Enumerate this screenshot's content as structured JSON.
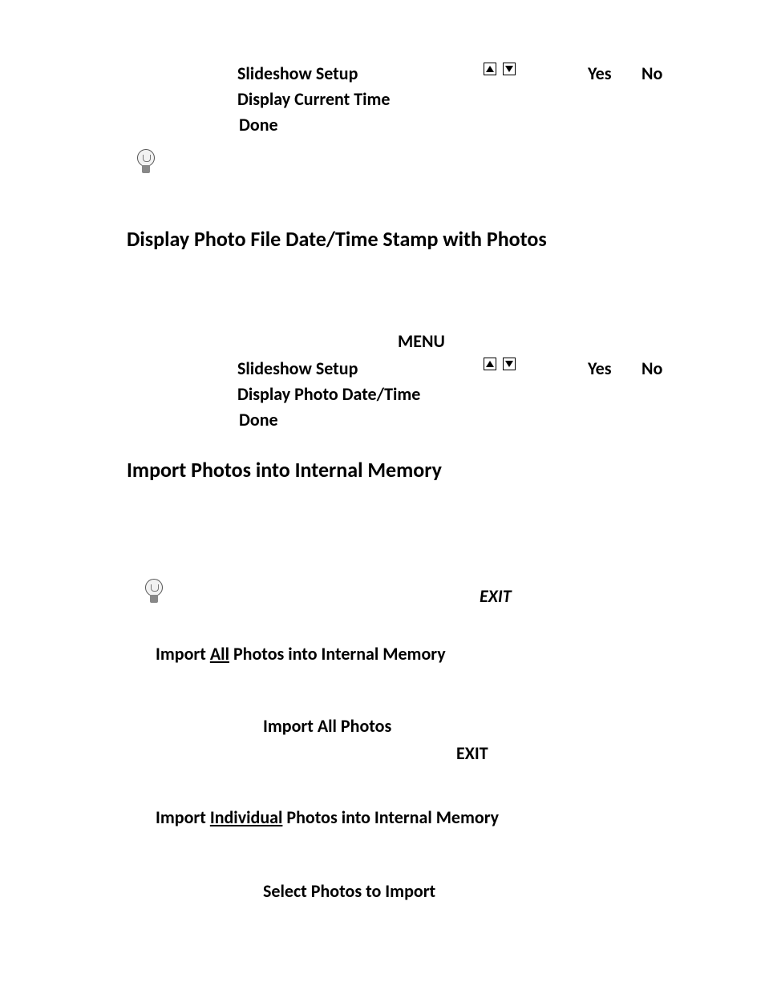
{
  "block1": {
    "line1_left": "Slideshow Setup",
    "line1_yes": "Yes",
    "line1_no": "No",
    "line2": "Display Current Time",
    "line3": "Done"
  },
  "heading1": "Display Photo File Date/Time Stamp with Photos",
  "menu_label": "MENU",
  "block2": {
    "line1_left": "Slideshow Setup",
    "line1_yes": "Yes",
    "line1_no": "No",
    "line2": "Display Photo Date/Time",
    "line3": "Done"
  },
  "heading2": "Import Photos into Internal Memory",
  "exit_italic": "EXIT",
  "import_all": {
    "prefix": "Import ",
    "underlined": "All",
    "suffix": " Photos into Internal Memory"
  },
  "import_all_photos": "Import All Photos",
  "exit_bold": "EXIT",
  "import_individual": {
    "prefix": "Import ",
    "underlined": "Individual",
    "suffix": " Photos into Internal Memory"
  },
  "select_photos": "Select Photos to Import"
}
